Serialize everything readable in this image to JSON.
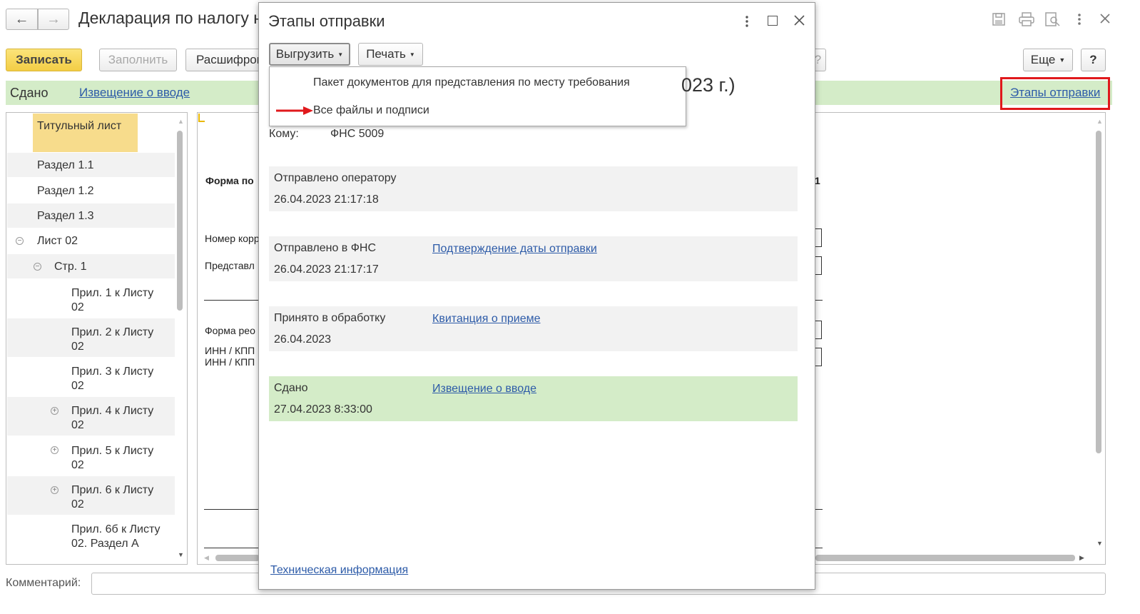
{
  "window": {
    "title": "Декларация по налогу н",
    "nav_back": "←",
    "nav_forward": "→"
  },
  "toolbar": {
    "save_label": "Записать",
    "fill_label": "Заполнить",
    "decode_label": "Расшифров",
    "more_label": "Еще",
    "help_label": "?"
  },
  "status_bar": {
    "status": "Сдано",
    "notice_link": "Извещение о вводе",
    "stages_link": "Этапы отправки"
  },
  "background_heading_fragment": "023 г.)",
  "sidebar": {
    "items": [
      {
        "label": "Титульный лист"
      },
      {
        "label": "Раздел 1.1"
      },
      {
        "label": "Раздел 1.2"
      },
      {
        "label": "Раздел 1.3"
      },
      {
        "label": "Лист 02"
      },
      {
        "label": "Стр. 1"
      },
      {
        "label": "Прил. 1 к Листу 02"
      },
      {
        "label": "Прил. 2 к Листу 02"
      },
      {
        "label": "Прил. 3 к Листу 02"
      },
      {
        "label": "Прил. 4 к Листу 02"
      },
      {
        "label": "Прил. 5 к Листу 02"
      },
      {
        "label": "Прил. 6 к Листу 02"
      },
      {
        "label": "Прил. 6б к Листу 02. Раздел А"
      }
    ]
  },
  "form_preview": {
    "form_title": "Форма по",
    "corr_number": "Номер корр",
    "presented": "Представл",
    "reorg_form": "Форма рео",
    "inn_kpp_1": "ИНН / КПП",
    "inn_kpp_2": "ИНН / КПП",
    "right_digit": "1"
  },
  "comment": {
    "label": "Комментарий:",
    "value": ""
  },
  "dialog": {
    "title": "Этапы отправки",
    "upload_button": "Выгрузить",
    "print_button": "Печать",
    "upload_menu": [
      "Пакет документов для представления по месту требования",
      "Все файлы и подписи"
    ],
    "to_label": "Кому:",
    "to_value": "ФНС 5009",
    "stages": [
      {
        "label": "Отправлено оператору",
        "date": "26.04.2023 21:17:18",
        "link": ""
      },
      {
        "label": "Отправлено в ФНС",
        "date": "26.04.2023 21:17:17",
        "link": "Подтверждение даты отправки"
      },
      {
        "label": "Принято в обработку",
        "date": "26.04.2023",
        "link": "Квитанция о приеме"
      },
      {
        "label": "Сдано",
        "date": "27.04.2023 8:33:00",
        "link": "Извещение о вводе"
      }
    ],
    "tech_info_link": "Техническая информация"
  },
  "colors": {
    "accent_yellow": "#f3cd45",
    "status_green": "#d4ecc8",
    "link_blue": "#2d5ba8",
    "highlight_red": "#e0191c"
  },
  "icons": [
    "save-icon",
    "print-icon",
    "preview-icon",
    "kebab-menu-icon",
    "close-icon",
    "maximize-icon",
    "red-arrow-icon"
  ]
}
